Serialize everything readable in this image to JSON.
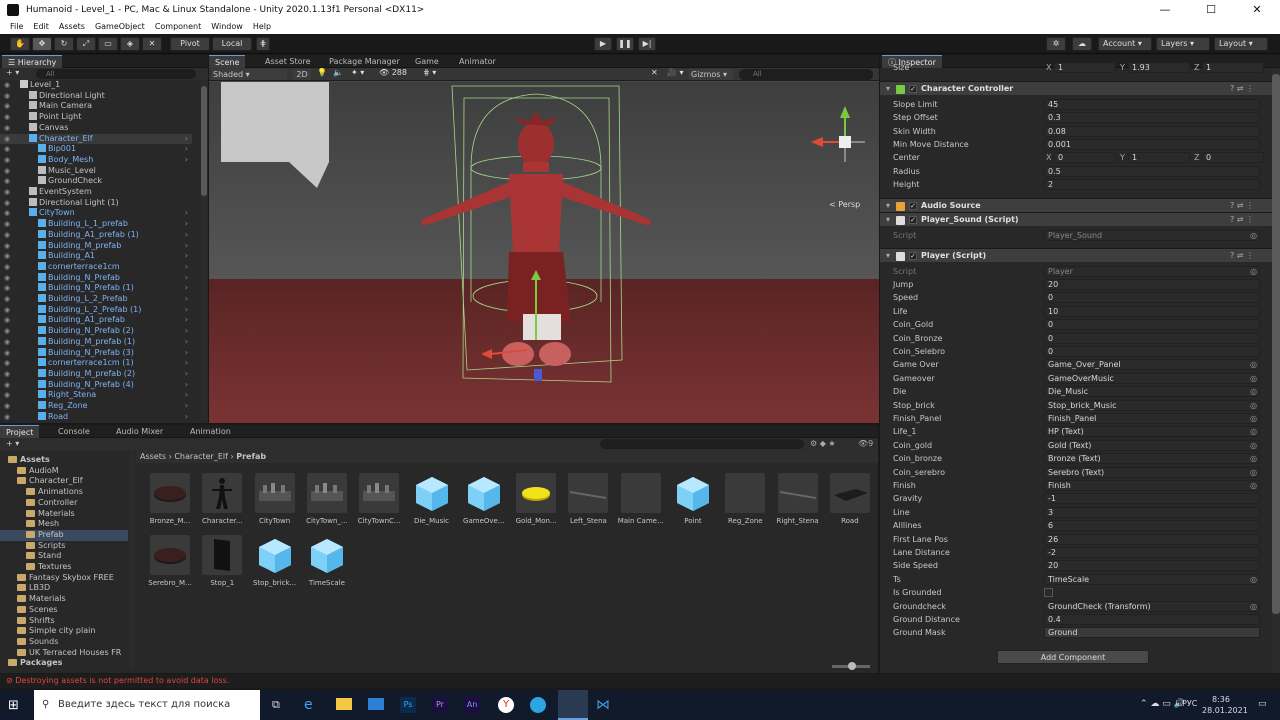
{
  "window": {
    "title": "Humanoid - Level_1 - PC, Mac & Linux Standalone - Unity 2020.1.13f1 Personal <DX11>"
  },
  "menu": [
    "File",
    "Edit",
    "Assets",
    "GameObject",
    "Component",
    "Window",
    "Help"
  ],
  "toolbar": {
    "pivot": "Pivot",
    "local": "Local",
    "account": "Account",
    "layers": "Layers",
    "layout": "Layout"
  },
  "hierarchy": {
    "tab": "Hierarchy",
    "search_placeholder": "All",
    "rows": [
      {
        "label": "Level_1",
        "indent": 0,
        "kind": "scene"
      },
      {
        "label": "Directional Light",
        "indent": 1,
        "kind": "go"
      },
      {
        "label": "Main Camera",
        "indent": 1,
        "kind": "go"
      },
      {
        "label": "Point Light",
        "indent": 1,
        "kind": "go"
      },
      {
        "label": "Canvas",
        "indent": 1,
        "kind": "go"
      },
      {
        "label": "Character_Elf",
        "indent": 1,
        "kind": "prefab"
      },
      {
        "label": "Bip001",
        "indent": 2,
        "kind": "prefab"
      },
      {
        "label": "Body_Mesh",
        "indent": 2,
        "kind": "prefab"
      },
      {
        "label": "Music_Level",
        "indent": 2,
        "kind": "go"
      },
      {
        "label": "GroundCheck",
        "indent": 2,
        "kind": "go"
      },
      {
        "label": "EventSystem",
        "indent": 1,
        "kind": "go"
      },
      {
        "label": "Directional Light (1)",
        "indent": 1,
        "kind": "go"
      },
      {
        "label": "CityTown",
        "indent": 1,
        "kind": "prefab"
      },
      {
        "label": "Building_L_1_prefab",
        "indent": 2,
        "kind": "prefab"
      },
      {
        "label": "Building_A1_prefab (1)",
        "indent": 2,
        "kind": "prefab"
      },
      {
        "label": "Building_M_prefab",
        "indent": 2,
        "kind": "prefab"
      },
      {
        "label": "Building_A1",
        "indent": 2,
        "kind": "prefab"
      },
      {
        "label": "cornerterrace1cm",
        "indent": 2,
        "kind": "prefab"
      },
      {
        "label": "Building_N_Prefab",
        "indent": 2,
        "kind": "prefab"
      },
      {
        "label": "Building_N_Prefab (1)",
        "indent": 2,
        "kind": "prefab"
      },
      {
        "label": "Building_L_2_Prefab",
        "indent": 2,
        "kind": "prefab"
      },
      {
        "label": "Building_L_2_Prefab (1)",
        "indent": 2,
        "kind": "prefab"
      },
      {
        "label": "Building_A1_prefab",
        "indent": 2,
        "kind": "prefab"
      },
      {
        "label": "Building_N_Prefab (2)",
        "indent": 2,
        "kind": "prefab"
      },
      {
        "label": "Building_M_prefab (1)",
        "indent": 2,
        "kind": "prefab"
      },
      {
        "label": "Building_N_Prefab (3)",
        "indent": 2,
        "kind": "prefab"
      },
      {
        "label": "cornerterrace1cm (1)",
        "indent": 2,
        "kind": "prefab"
      },
      {
        "label": "Building_M_prefab (2)",
        "indent": 2,
        "kind": "prefab"
      },
      {
        "label": "Building_N_Prefab (4)",
        "indent": 2,
        "kind": "prefab"
      },
      {
        "label": "Right_Stena",
        "indent": 2,
        "kind": "prefab"
      },
      {
        "label": "Reg_Zone",
        "indent": 2,
        "kind": "prefab"
      },
      {
        "label": "Road",
        "indent": 2,
        "kind": "prefab"
      }
    ]
  },
  "scene": {
    "tabs": [
      "Scene",
      "Asset Store",
      "Package Manager",
      "Game",
      "Animator"
    ],
    "shading": "Shaded",
    "mode2d": "2D",
    "gizmos": "Gizmos",
    "search_placeholder": "All",
    "counter": "288",
    "persp": "< Persp"
  },
  "project": {
    "tabs": [
      "Project",
      "Console",
      "Audio Mixer",
      "Animation"
    ],
    "breadcrumb": [
      "Assets",
      "Character_Elf",
      "Prefab"
    ],
    "count": "9",
    "tree": [
      {
        "label": "Assets",
        "indent": 0,
        "bold": true
      },
      {
        "label": "AudioM",
        "indent": 1
      },
      {
        "label": "Character_Elf",
        "indent": 1
      },
      {
        "label": "Animations",
        "indent": 2
      },
      {
        "label": "Controller",
        "indent": 2
      },
      {
        "label": "Materials",
        "indent": 2
      },
      {
        "label": "Mesh",
        "indent": 2
      },
      {
        "label": "Prefab",
        "indent": 2,
        "selected": true
      },
      {
        "label": "Scripts",
        "indent": 2
      },
      {
        "label": "Stand",
        "indent": 2
      },
      {
        "label": "Textures",
        "indent": 2
      },
      {
        "label": "Fantasy Skybox FREE",
        "indent": 1
      },
      {
        "label": "LB3D",
        "indent": 1
      },
      {
        "label": "Materials",
        "indent": 1
      },
      {
        "label": "Scenes",
        "indent": 1
      },
      {
        "label": "Shrifts",
        "indent": 1
      },
      {
        "label": "Simple city plain",
        "indent": 1
      },
      {
        "label": "Sounds",
        "indent": 1
      },
      {
        "label": "UK Terraced Houses FR",
        "indent": 1
      },
      {
        "label": "Packages",
        "indent": 0,
        "bold": true
      }
    ],
    "assets": [
      {
        "name": "Bronze_M...",
        "thumb": "disc-dark"
      },
      {
        "name": "Character...",
        "thumb": "figure"
      },
      {
        "name": "CityTown",
        "thumb": "city"
      },
      {
        "name": "CityTown_...",
        "thumb": "city"
      },
      {
        "name": "CityTownC...",
        "thumb": "city"
      },
      {
        "name": "Die_Music",
        "thumb": "cube"
      },
      {
        "name": "GameOve...",
        "thumb": "cube"
      },
      {
        "name": "Gold_Mon...",
        "thumb": "disc-gold"
      },
      {
        "name": "Left_Stena",
        "thumb": "wall"
      },
      {
        "name": "Main Came...",
        "thumb": "blank"
      },
      {
        "name": "Point",
        "thumb": "cube"
      },
      {
        "name": "Reg_Zone",
        "thumb": "blank"
      },
      {
        "name": "Right_Stena",
        "thumb": "wall"
      },
      {
        "name": "Road",
        "thumb": "road"
      },
      {
        "name": "Serebro_M...",
        "thumb": "disc-dark"
      },
      {
        "name": "Stop_1",
        "thumb": "slab"
      },
      {
        "name": "Stop_brick...",
        "thumb": "cube"
      },
      {
        "name": "TimeScale",
        "thumb": "cube"
      }
    ]
  },
  "console": {
    "error": "Destroying assets is not permitted to avoid data loss."
  },
  "inspector": {
    "tab": "Inspector",
    "size_row": {
      "label": "Size",
      "x": "1",
      "y": "1.93",
      "z": "1"
    },
    "cc": {
      "title": "Character Controller",
      "fields": [
        {
          "k": "Slope Limit",
          "v": "45"
        },
        {
          "k": "Step Offset",
          "v": "0.3"
        },
        {
          "k": "Skin Width",
          "v": "0.08"
        },
        {
          "k": "Min Move Distance",
          "v": "0.001"
        }
      ],
      "center": {
        "label": "Center",
        "x": "0",
        "y": "1",
        "z": "0"
      },
      "fields2": [
        {
          "k": "Radius",
          "v": "0.5"
        },
        {
          "k": "Height",
          "v": "2"
        }
      ]
    },
    "audio": {
      "title": "Audio Source"
    },
    "player_sound": {
      "title": "Player_Sound (Script)",
      "script_label": "Script",
      "script": "Player_Sound"
    },
    "player": {
      "title": "Player (Script)",
      "script_label": "Script",
      "script": "Player",
      "fields": [
        {
          "k": "Jump",
          "v": "20"
        },
        {
          "k": "Speed",
          "v": "0"
        },
        {
          "k": "Life",
          "v": "10"
        },
        {
          "k": "Coin_Gold",
          "v": "0"
        },
        {
          "k": "Coin_Bronze",
          "v": "0"
        },
        {
          "k": "Coin_Selebro",
          "v": "0"
        },
        {
          "k": "Game Over",
          "v": "Game_Over_Panel",
          "obj": true
        },
        {
          "k": "Gameover",
          "v": "GameOverMusic",
          "obj": true
        },
        {
          "k": "Die",
          "v": "Die_Music",
          "obj": true
        },
        {
          "k": "Stop_brick",
          "v": "Stop_brick_Music",
          "obj": true
        },
        {
          "k": "Finish_Panel",
          "v": "Finish_Panel",
          "obj": true
        },
        {
          "k": "Life_1",
          "v": "HP (Text)",
          "obj": true
        },
        {
          "k": "Coin_gold",
          "v": "Gold (Text)",
          "obj": true
        },
        {
          "k": "Coin_bronze",
          "v": "Bronze (Text)",
          "obj": true
        },
        {
          "k": "Coin_serebro",
          "v": "Serebro (Text)",
          "obj": true
        },
        {
          "k": "Finish",
          "v": "Finish",
          "obj": true
        },
        {
          "k": "Gravity",
          "v": "-1"
        },
        {
          "k": "Line",
          "v": "3"
        },
        {
          "k": "Alllines",
          "v": "6"
        },
        {
          "k": "First Lane Pos",
          "v": "26"
        },
        {
          "k": "Lane Distance",
          "v": "-2"
        },
        {
          "k": "Side Speed",
          "v": "20"
        },
        {
          "k": "Ts",
          "v": "TimeScale",
          "obj": true
        },
        {
          "k": "Is Grounded",
          "v": ""
        },
        {
          "k": "Groundcheck",
          "v": "GroundCheck (Transform)",
          "obj": true
        },
        {
          "k": "Ground Distance",
          "v": "0.4"
        },
        {
          "k": "Ground Mask",
          "v": "Ground",
          "dropdown": true
        }
      ]
    },
    "add_component": "Add Component"
  },
  "taskbar": {
    "search": "Введите здесь текст для поиска",
    "lang": "РУС",
    "time": "8:36",
    "date": "28.01.2021"
  }
}
